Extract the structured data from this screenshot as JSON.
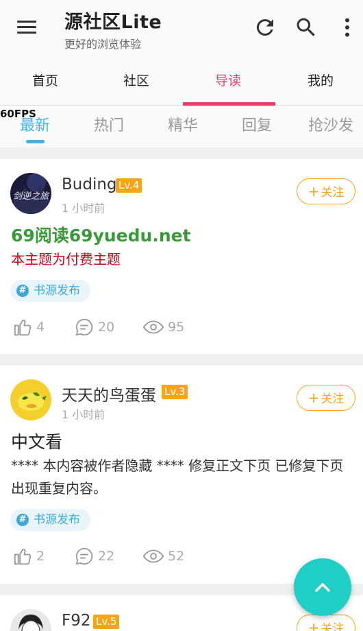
{
  "app": {
    "title": "源社区Lite",
    "subtitle": "更好的浏览体验"
  },
  "appbar_icons": [
    "menu-icon",
    "refresh-icon",
    "search-icon",
    "more-vert-icon"
  ],
  "tabs": [
    {
      "label": "首页"
    },
    {
      "label": "社区"
    },
    {
      "label": "导读",
      "active": true
    },
    {
      "label": "我的"
    }
  ],
  "fps": "60FPS",
  "subtabs": [
    {
      "label": "最新",
      "active": true
    },
    {
      "label": "热门"
    },
    {
      "label": "精华"
    },
    {
      "label": "回复"
    },
    {
      "label": "抢沙发"
    }
  ],
  "colors": {
    "accent_tab": "#ee3a68",
    "accent_subtab": "#3fb3e9",
    "level_badge": "#f7a415",
    "fab": "#1fcfc6",
    "title_green": "#3a9a3a",
    "paid_red": "#d0021b"
  },
  "posts": [
    {
      "user": "Buding",
      "level": "Lv.4",
      "time": "1 小时前",
      "follow": "关注",
      "title": "69阅读69yuedu.net",
      "desc": "本主题为付费主题",
      "tag": "书源发布",
      "likes": "4",
      "comments": "20",
      "views": "95"
    },
    {
      "user": "天天的鸟蛋蛋",
      "level": "Lv.3",
      "time": "1 小时前",
      "follow": "关注",
      "title": "中文看",
      "desc": "**** 本内容被作者隐藏 **** 修复正文下页 已修复下页出现重复内容。",
      "tag": "书源发布",
      "likes": "2",
      "comments": "22",
      "views": "52"
    },
    {
      "user": "F92",
      "level": "Lv.5",
      "follow": "关注"
    }
  ]
}
